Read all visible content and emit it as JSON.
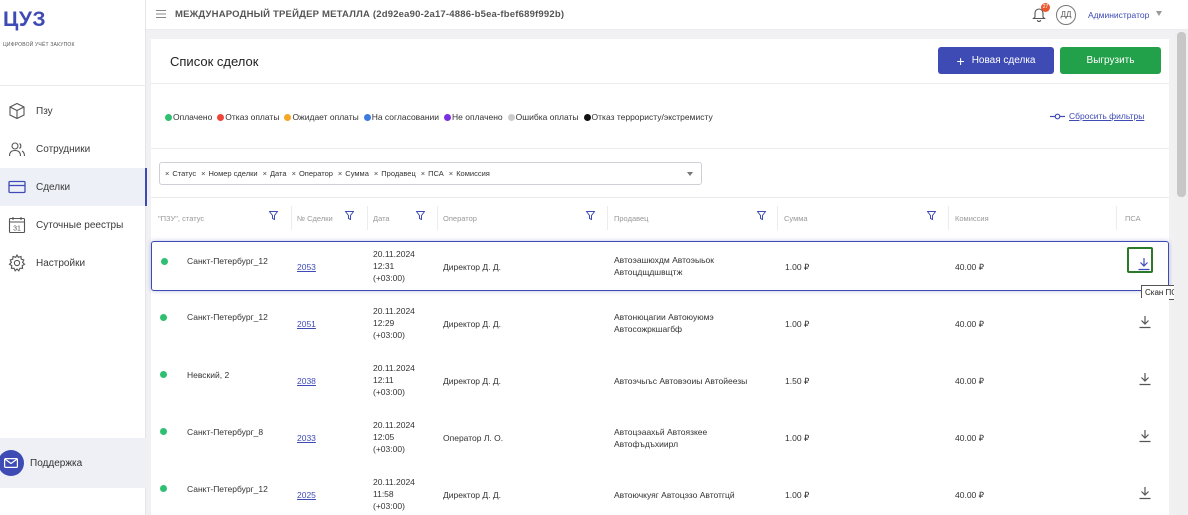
{
  "sidebar": {
    "logo": "ЦУЗ",
    "logo_subtitle": "ЦИФРОВОЙ УЧЁТ ЗАКУПОК",
    "items": [
      {
        "label": "Пзу",
        "icon": "cube-icon"
      },
      {
        "label": "Сотрудники",
        "icon": "users-icon"
      },
      {
        "label": "Сделки",
        "icon": "card-icon",
        "active": true
      },
      {
        "label": "Суточные реестры",
        "icon": "calendar-icon"
      },
      {
        "label": "Настройки",
        "icon": "gear-icon"
      }
    ],
    "support_label": "Поддержка"
  },
  "topbar": {
    "org_title": "МЕЖДУНАРОДНЫЙ ТРЕЙДЕР МЕТАЛЛА (2d92ea90-2a17-4886-b5ea-fbef689f992b)",
    "notification_count": "27",
    "avatar_initials": "ДД",
    "user_role": "Администратор"
  },
  "page": {
    "title": "Список сделок",
    "new_deal_label": "Новая сделка",
    "export_label": "Выгрузить"
  },
  "legend": [
    {
      "label": "Оплачено",
      "color": "#2fbf71"
    },
    {
      "label": "Отказ оплаты",
      "color": "#f0453a"
    },
    {
      "label": "Ожидает оплаты",
      "color": "#f5a623"
    },
    {
      "label": "На согласовании",
      "color": "#3d7be0"
    },
    {
      "label": "Не оплачено",
      "color": "#7b2fe0"
    },
    {
      "label": "Ошибка оплаты",
      "color": "#cccccc"
    },
    {
      "label": "Отказ террористу/экстремисту",
      "color": "#111111"
    }
  ],
  "reset_filters_label": "Сбросить фильтры",
  "column_chips": [
    "Статус",
    "Номер сделки",
    "Дата",
    "Оператор",
    "Сумма",
    "Продавец",
    "ПСА",
    "Комиссия"
  ],
  "table": {
    "headers": {
      "status": "\"ПЗУ\", статус",
      "number": "№ Сделки",
      "date": "Дата",
      "operator": "Оператор",
      "seller": "Продавец",
      "sum": "Сумма",
      "commission": "Комиссия",
      "psa": "ПСА"
    },
    "rows": [
      {
        "point": "Санкт-Петербург_12",
        "number": "2053",
        "date": "20.11.2024",
        "time": "12:31",
        "tz": "(+03:00)",
        "operator": "Директор Д. Д.",
        "seller1": "Автоэашюхдм Автоэыьок",
        "seller2": "Автоцдщдшвщтж",
        "sum": "1.00 ₽",
        "commission": "40.00 ₽"
      },
      {
        "point": "Санкт-Петербург_12",
        "number": "2051",
        "date": "20.11.2024",
        "time": "12:29",
        "tz": "(+03:00)",
        "operator": "Директор Д. Д.",
        "seller1": "Автонюцагии Автоюуюмэ",
        "seller2": "Автосожркшагбф",
        "sum": "1.00 ₽",
        "commission": "40.00 ₽"
      },
      {
        "point": "Невский, 2",
        "number": "2038",
        "date": "20.11.2024",
        "time": "12:11",
        "tz": "(+03:00)",
        "operator": "Директор Д. Д.",
        "seller1": "Автоэчыъс Автовэоиы Автойеезы",
        "seller2": "",
        "sum": "1.50 ₽",
        "commission": "40.00 ₽"
      },
      {
        "point": "Санкт-Петербург_8",
        "number": "2033",
        "date": "20.11.2024",
        "time": "12:05",
        "tz": "(+03:00)",
        "operator": "Оператор Л. О.",
        "seller1": "Автоцэаахьй Автоязкее",
        "seller2": "Автофъдъхиирл",
        "sum": "1.00 ₽",
        "commission": "40.00 ₽"
      },
      {
        "point": "Санкт-Петербург_12",
        "number": "2025",
        "date": "20.11.2024",
        "time": "11:58",
        "tz": "(+03:00)",
        "operator": "Директор Д. Д.",
        "seller1": "Автоючкуяг Автоцэзо Автотгцй",
        "seller2": "",
        "sum": "1.00 ₽",
        "commission": "40.00 ₽"
      }
    ]
  },
  "tooltip_text": "Скан ПСА"
}
